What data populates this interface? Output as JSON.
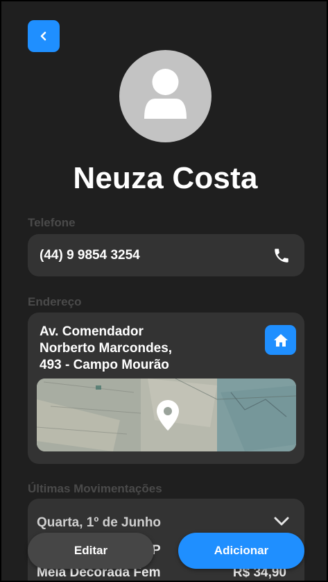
{
  "colors": {
    "accent": "#1f8fff",
    "background": "#1f1f1f",
    "card": "#333333",
    "label": "#4a4a4a"
  },
  "header": {
    "back_icon": "chevron-left-icon"
  },
  "profile": {
    "avatar_icon": "user-icon",
    "name": "Neuza Costa"
  },
  "phone": {
    "label": "Telefone",
    "value": "(44) 9 9854 3254",
    "icon": "phone-icon"
  },
  "address": {
    "label": "Endereço",
    "value": "Av. Comendador\nNorberto Marcondes,\n493 - Campo Mourão",
    "home_icon": "home-icon",
    "map_icon": "map-pin-icon"
  },
  "history": {
    "label": "Últimas Movimentações",
    "date": "Quarta, 1º de Junho",
    "expand_icon": "chevron-down-icon",
    "rows": [
      {
        "item": "P",
        "price": ""
      },
      {
        "item": "Meia Decorada Fem",
        "price": "R$ 34,90"
      }
    ]
  },
  "actions": {
    "edit_label": "Editar",
    "add_label": "Adicionar"
  }
}
